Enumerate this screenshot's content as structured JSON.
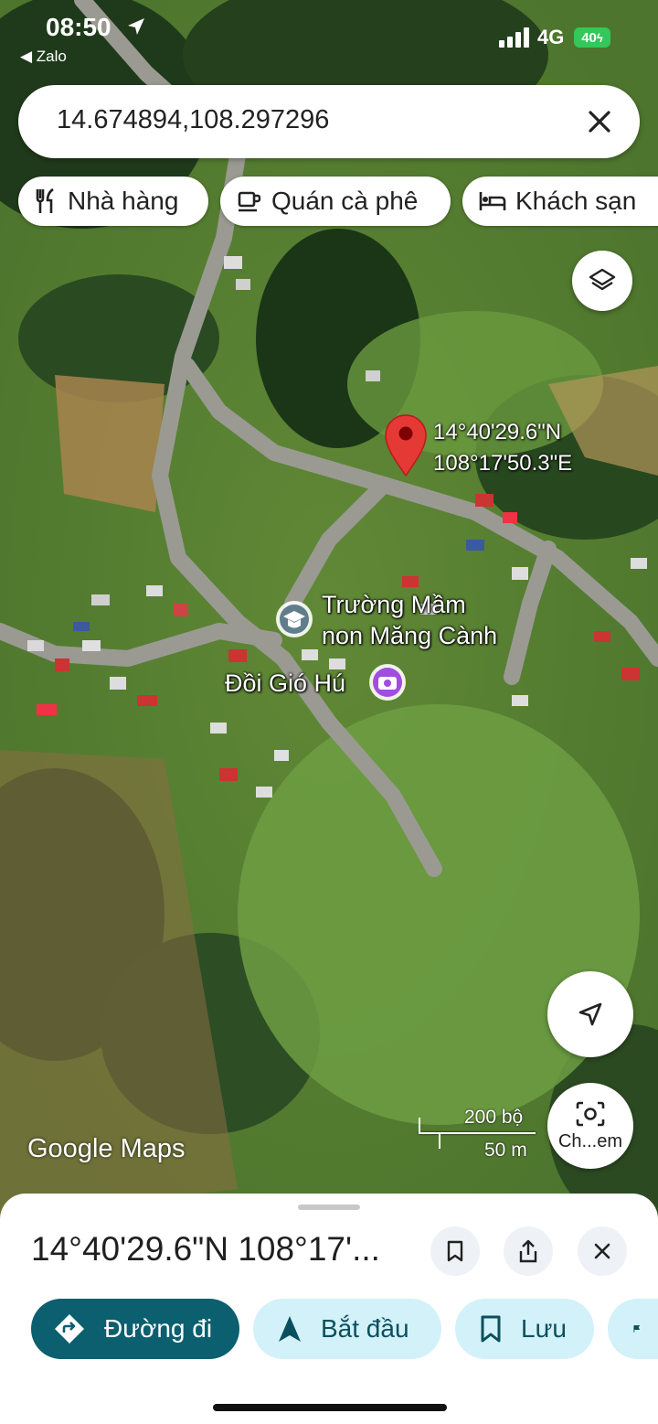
{
  "status_bar": {
    "time": "08:50",
    "back_app": "◀ Zalo",
    "network": "4G",
    "battery": "40"
  },
  "search": {
    "value": "14.674894,108.297296"
  },
  "chips": [
    {
      "label": "Nhà hàng",
      "icon": "restaurant-icon"
    },
    {
      "label": "Quán cà phê",
      "icon": "coffee-icon"
    },
    {
      "label": "Khách sạn",
      "icon": "hotel-icon"
    }
  ],
  "map": {
    "pin": {
      "lat": "14°40'29.6\"N",
      "lng": "108°17'50.3\"E"
    },
    "places": [
      {
        "name_line1": "Trường Mầm",
        "name_line2": "non Măng Cành",
        "icon": "school-icon"
      },
      {
        "name": "Đồi Gió Hú",
        "icon": "camera-icon"
      }
    ],
    "logo": "Google Maps",
    "scale": {
      "imperial": "200 bộ",
      "metric": "50 m"
    },
    "lens_button_label": "Ch...em"
  },
  "sheet": {
    "title": "14°40'29.6\"N 108°17'...",
    "actions": [
      {
        "label": "Đường đi",
        "icon": "directions-icon"
      },
      {
        "label": "Bắt đầu",
        "icon": "navigation-icon"
      },
      {
        "label": "Lưu",
        "icon": "bookmark-icon"
      }
    ]
  },
  "colors": {
    "primary": "#0b5f6e",
    "pill_light": "#d3f1f8",
    "pin": "#e53935",
    "battery": "#34c759"
  }
}
